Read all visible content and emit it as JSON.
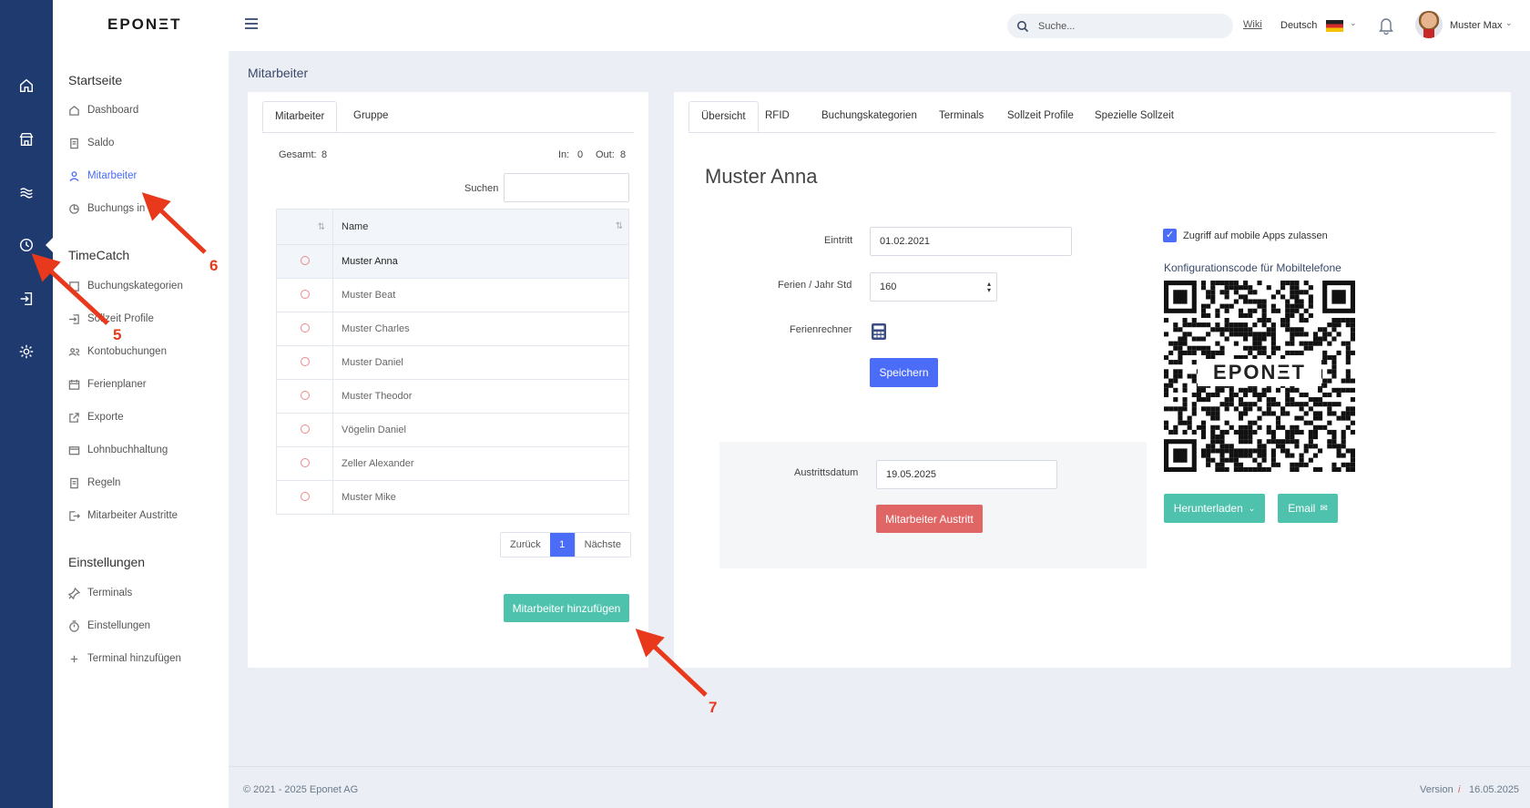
{
  "brand": {
    "logo": "EPONΞT"
  },
  "topbar": {
    "menu_icon": "hamburger-icon",
    "search_placeholder": "Suche...",
    "wiki": "Wiki",
    "language": "Deutsch",
    "user": "Muster Max"
  },
  "sidebar": {
    "sections": [
      {
        "title": "Startseite"
      },
      {
        "title": "TimeCatch"
      },
      {
        "title": "Einstellungen"
      }
    ],
    "items": [
      {
        "label": "Dashboard",
        "icon": "home-icon"
      },
      {
        "label": "Saldo",
        "icon": "document-icon"
      },
      {
        "label": "Mitarbeiter",
        "icon": "user-icon"
      },
      {
        "label": "Buchungs in",
        "icon": "pie-icon"
      },
      {
        "label": "Buchungskategorien",
        "icon": "list-icon"
      },
      {
        "label": "Sollzeit Profile",
        "icon": "login-icon"
      },
      {
        "label": "Kontobuchungen",
        "icon": "users-icon"
      },
      {
        "label": "Ferienplaner",
        "icon": "calendar-icon"
      },
      {
        "label": "Exporte",
        "icon": "export-icon"
      },
      {
        "label": "Lohnbuchhaltung",
        "icon": "wallet-icon"
      },
      {
        "label": "Regeln",
        "icon": "document-icon"
      },
      {
        "label": "Mitarbeiter Austritte",
        "icon": "logout-icon"
      },
      {
        "label": "Terminals",
        "icon": "pin-icon"
      },
      {
        "label": "Einstellungen",
        "icon": "timer-icon"
      },
      {
        "label": "Terminal hinzufügen",
        "icon": "plus-icon"
      }
    ]
  },
  "page": {
    "title": "Mitarbeiter"
  },
  "left_panel": {
    "tabs": [
      "Mitarbeiter",
      "Gruppe"
    ],
    "total_label": "Gesamt:",
    "total": "8",
    "in_label": "In:",
    "in": "0",
    "out_label": "Out:",
    "out": "8",
    "search_label": "Suchen",
    "table_header": "Name",
    "rows": [
      "Muster Anna",
      "Muster Beat",
      "Muster Charles",
      "Muster Daniel",
      "Muster Theodor",
      "Vögelin Daniel",
      "Zeller Alexander",
      "Muster Mike"
    ],
    "pagination": {
      "prev": "Zurück",
      "page": "1",
      "next": "Nächste"
    },
    "add_button": "Mitarbeiter hinzufügen"
  },
  "right_panel": {
    "tabs": [
      "Übersicht",
      "RFID",
      "Buchungskategorien",
      "Terminals",
      "Sollzeit Profile",
      "Spezielle Sollzeit"
    ],
    "employee_name": "Muster Anna",
    "eintritt_label": "Eintritt",
    "eintritt": "01.02.2021",
    "ferien_label": "Ferien / Jahr Std",
    "ferien": "160",
    "ferienrechner_label": "Ferienrechner",
    "save_button": "Speichern",
    "austritt_label": "Austrittsdatum",
    "austritt": "19.05.2025",
    "austritt_button": "Mitarbeiter Austritt",
    "mobile_checkbox": "Zugriff auf mobile Apps zulassen",
    "qr_title": "Konfigurationscode für Mobiltelefone",
    "qr_logo": "EPONΞT",
    "download_button": "Herunterladen",
    "email_button": "Email"
  },
  "footer": {
    "copyright": "© 2021 - 2025 Eponet AG",
    "version_label": "Version",
    "version_date": "16.05.2025"
  },
  "annotations": [
    "5",
    "6",
    "7"
  ],
  "colors": {
    "rail": "#1e3a6e",
    "primary": "#4a6cf7",
    "teal": "#4fc2ad",
    "danger": "#e06565",
    "annotation": "#e8391d"
  }
}
